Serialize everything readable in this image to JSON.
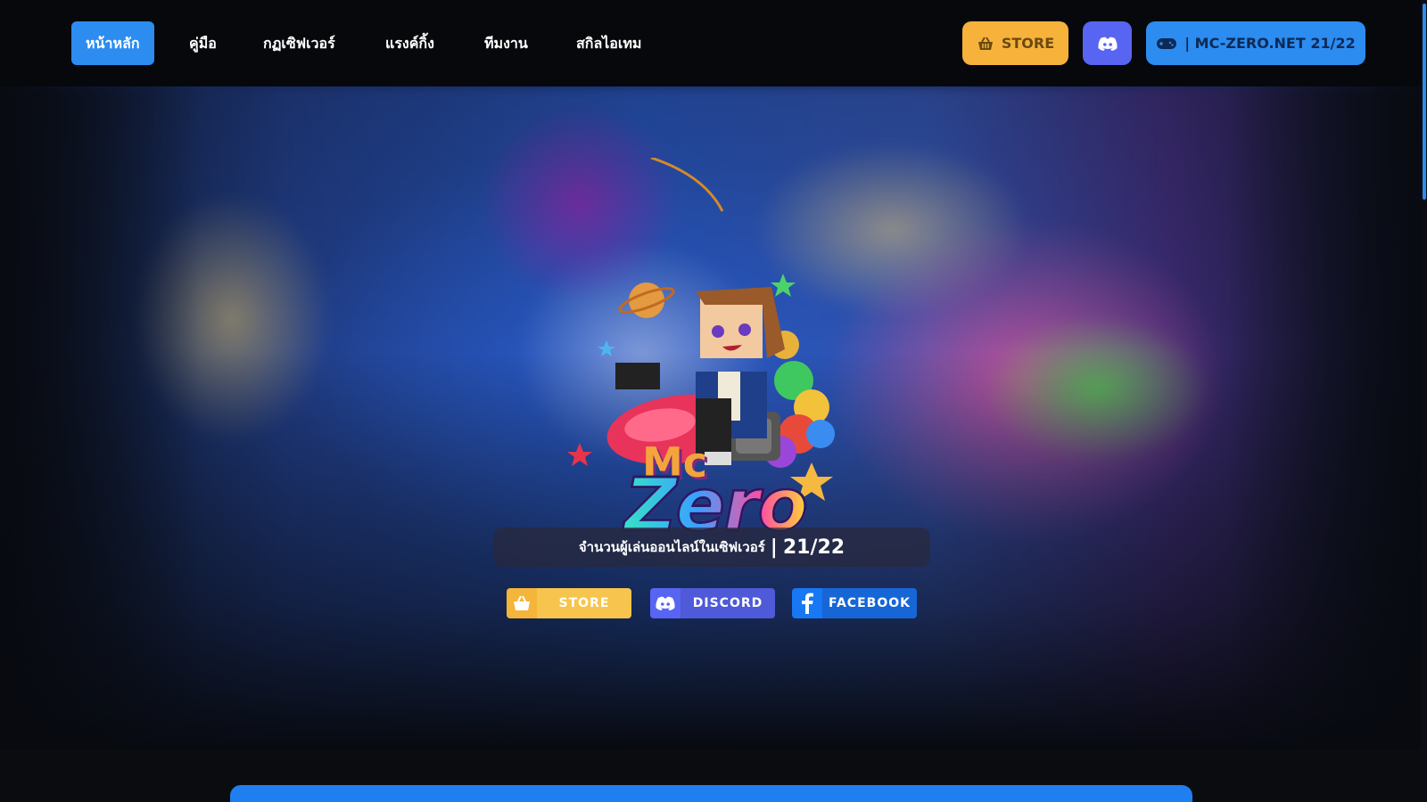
{
  "nav": {
    "items": [
      {
        "label": "หน้าหลัก",
        "active": true
      },
      {
        "label": "คู่มือ",
        "active": false
      },
      {
        "label": "กฏเซิฟเวอร์",
        "active": false
      },
      {
        "label": "แรงค์กิ้ง",
        "active": false
      },
      {
        "label": "ทีมงาน",
        "active": false
      },
      {
        "label": "สกิลไอเทม",
        "active": false
      }
    ],
    "store_label": "STORE",
    "server_label": "| MC-ZERO.NET 21/22",
    "icons": {
      "store": "basket-icon",
      "discord": "discord-icon",
      "server": "gamepad-icon"
    }
  },
  "hero": {
    "logo_text": {
      "mc": "Mc",
      "zero": "Zero"
    },
    "online_label": "จำนวนผู้เล่นออนไลน์ในเซิฟเวอร์",
    "online_separator": "|",
    "online_count": "21/22",
    "social_buttons": [
      {
        "label": "STORE",
        "icon": "basket-icon"
      },
      {
        "label": "DISCORD",
        "icon": "discord-icon"
      },
      {
        "label": "FACEBOOK",
        "icon": "facebook-icon"
      }
    ]
  },
  "colors": {
    "primary": "#2c8cf0",
    "store": "#f7b23b",
    "discord": "#5865f2",
    "facebook": "#1877f2",
    "background": "#0b0d12"
  }
}
